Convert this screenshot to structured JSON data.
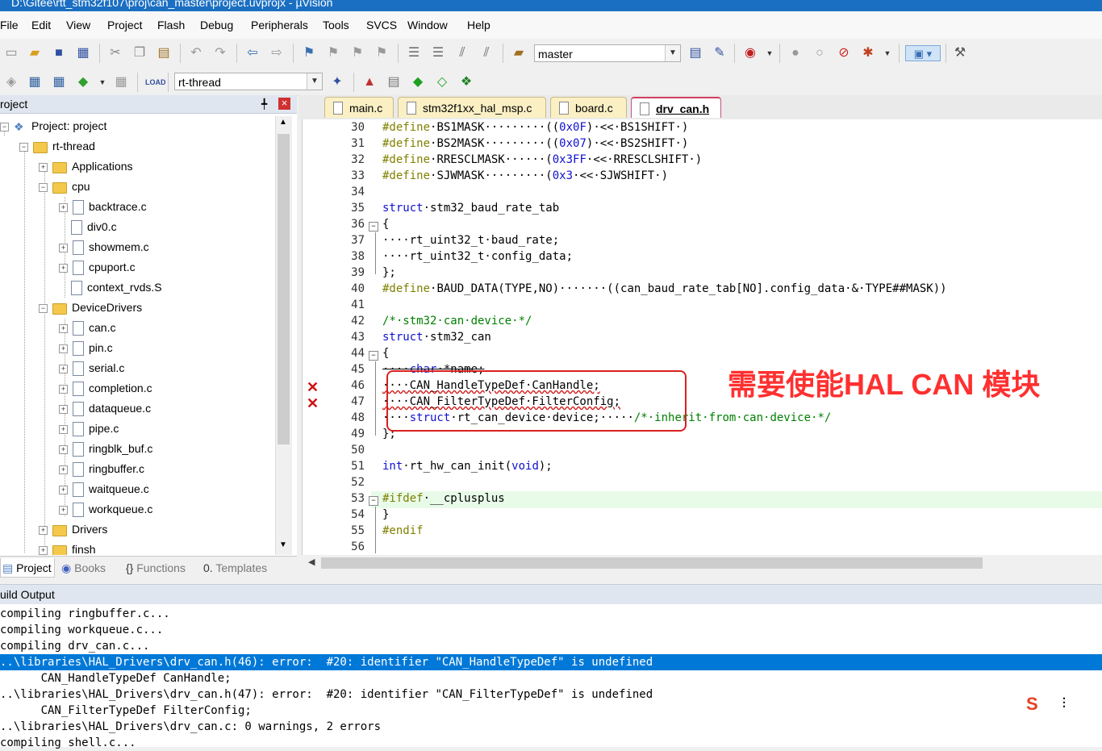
{
  "window": {
    "title": "D:\\Gitee\\rtt_stm32f107\\proj\\can_master\\project.uvprojx - µVision"
  },
  "menu": [
    "File",
    "Edit",
    "View",
    "Project",
    "Flash",
    "Debug",
    "Peripherals",
    "Tools",
    "SVCS",
    "Window",
    "Help"
  ],
  "toolbar1": {
    "branch_combo": "master"
  },
  "toolbar2": {
    "target_combo": "rt-thread"
  },
  "project_panel": {
    "title": "roject",
    "pin": "╇",
    "close": "×",
    "tree": [
      {
        "label": "Project: project"
      },
      {
        "label": "rt-thread"
      },
      {
        "label": "Applications"
      },
      {
        "label": "cpu"
      },
      {
        "label": "backtrace.c"
      },
      {
        "label": "div0.c"
      },
      {
        "label": "showmem.c"
      },
      {
        "label": "cpuport.c"
      },
      {
        "label": "context_rvds.S"
      },
      {
        "label": "DeviceDrivers"
      },
      {
        "label": "can.c"
      },
      {
        "label": "pin.c"
      },
      {
        "label": "serial.c"
      },
      {
        "label": "completion.c"
      },
      {
        "label": "dataqueue.c"
      },
      {
        "label": "pipe.c"
      },
      {
        "label": "ringblk_buf.c"
      },
      {
        "label": "ringbuffer.c"
      },
      {
        "label": "waitqueue.c"
      },
      {
        "label": "workqueue.c"
      },
      {
        "label": "Drivers"
      },
      {
        "label": "finsh"
      }
    ],
    "tabs": [
      "Project",
      "Books",
      "Functions",
      "Templates"
    ]
  },
  "editor": {
    "tabs": [
      "main.c",
      "stm32f1xx_hal_msp.c",
      "board.c",
      "drv_can.h"
    ],
    "active_tab": "drv_can.h",
    "line_numbers": [
      "30",
      "31",
      "32",
      "33",
      "34",
      "35",
      "36",
      "37",
      "38",
      "39",
      "40",
      "41",
      "42",
      "43",
      "44",
      "45",
      "46",
      "47",
      "48",
      "49",
      "50",
      "51",
      "52",
      "53",
      "54",
      "55",
      "56"
    ],
    "lines": [
      "#define·BS1MASK·········((0x0F)·<<·BS1SHIFT·)",
      "#define·BS2MASK·········((0x07)·<<·BS2SHIFT·)",
      "#define·RRESCLMASK······(0x3FF·<<·RRESCLSHIFT·)",
      "#define·SJWMASK·········(0x3·<<·SJWSHIFT·)",
      "",
      "struct·stm32_baud_rate_tab",
      "{",
      "····rt_uint32_t·baud_rate;",
      "····rt_uint32_t·config_data;",
      "};",
      "#define·BAUD_DATA(TYPE,NO)·······((can_baud_rate_tab[NO].config_data·&·TYPE##MASK))",
      "",
      "/*·stm32·can·device·*/",
      "struct·stm32_can",
      "{",
      "····char·*name;",
      "····CAN_HandleTypeDef·CanHandle;",
      "····CAN_FilterTypeDef·FilterConfig;",
      "····struct·rt_can_device·device;·····/*·inherit·from·can·device·*/",
      "};",
      "",
      "int·rt_hw_can_init(void);",
      "",
      "#ifdef·__cplusplus",
      "}",
      "#endif",
      ""
    ],
    "error_marker": "✕",
    "annotation": "需要使能HAL CAN 模块"
  },
  "build_output": {
    "title": "uild Output",
    "lines": [
      "compiling ringbuffer.c...",
      "compiling workqueue.c...",
      "compiling drv_can.c...",
      "..\\libraries\\HAL_Drivers\\drv_can.h(46): error:  #20: identifier \"CAN_HandleTypeDef\" is undefined",
      "      CAN_HandleTypeDef CanHandle;",
      "..\\libraries\\HAL_Drivers\\drv_can.h(47): error:  #20: identifier \"CAN_FilterTypeDef\" is undefined",
      "      CAN_FilterTypeDef FilterConfig;",
      "..\\libraries\\HAL_Drivers\\drv_can.c: 0 warnings, 2 errors",
      "compiling shell.c..."
    ],
    "selected_line": 3
  },
  "colors": {
    "title_bar": "#1b6fc2",
    "selection": "#0078d7",
    "annotation": "#ff3030",
    "callout_border": "#d92020"
  }
}
